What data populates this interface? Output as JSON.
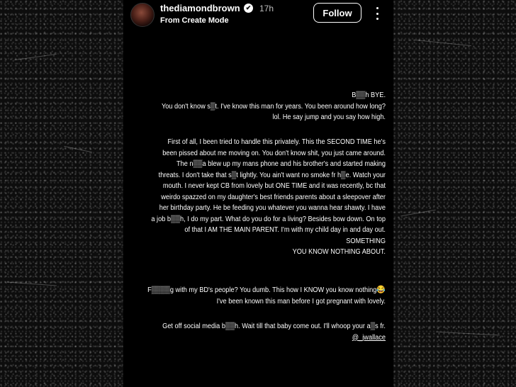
{
  "post": {
    "username": "thediamondbrown",
    "verified_badge": "✔",
    "time": "17h",
    "subtitle": "From Create Mode",
    "follow_label": "Follow",
    "more_icon": "vertical-ellipsis"
  },
  "story_text": {
    "p1": [
      "B▒▒h BYE.",
      "You don't know s▒t. I've know this man for years. You been around how long?",
      "lol. He say jump and you say how high."
    ],
    "p2": [
      "First of all, I been tried to handle this privately. This the SECOND TIME  he's",
      "been pissed about me moving on. You don't know shit, you just came around.",
      "The n▒▒a blew up my mans phone and his brother's and started making",
      "threats. I don't take that s▒t lightly. You ain't want no smoke fr h▒e. Watch your",
      "mouth. I never kept CB from lovely but ONE TIME and it was recently, bc that",
      "weirdo spazzed on my daughter's best friends parents about a sleepover after",
      "her birthday party.  He be feeding you whatever you wanna hear shawty. I have",
      "a job b▒▒h, I do my part. What do you do for a living?  Besides bow down. On top",
      "of that I AM THE MAIN PARENT. I'm with my child day in and day out. SOMETHING",
      "YOU KNOW NOTHING ABOUT."
    ],
    "p3_line1": "F▒▒▒▒g with my BD's people? You dumb. This how I KNOW you know nothing",
    "p3_emoji": "😂",
    "p3_line2": "I've been known this man before I got pregnant with lovely.",
    "p4_line1": "Get off social media b▒▒h. Wait till that baby come out.  I'll whoop  your a▒s fr.",
    "p4_mention": "@_jwallace"
  },
  "colors": {
    "story_bg": "#000000",
    "text": "#ffffff",
    "muted": "#bdbdbd"
  }
}
